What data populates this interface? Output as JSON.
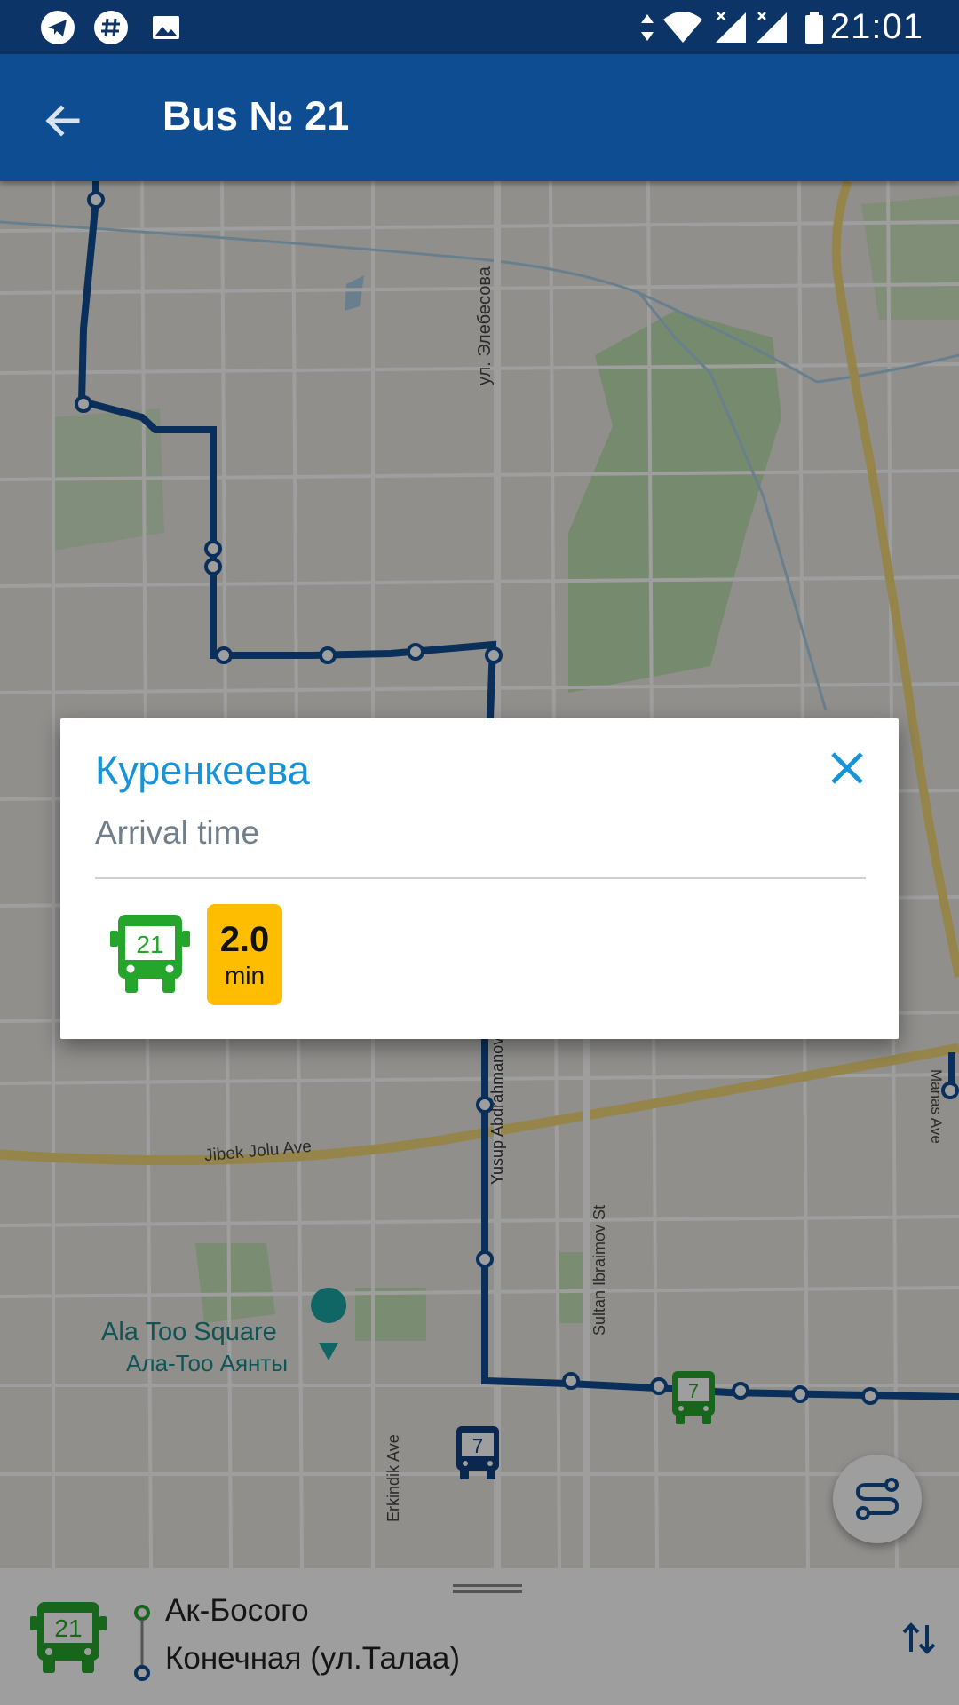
{
  "status_bar": {
    "time": "21:01",
    "left_icons": [
      "telegram-icon",
      "hashtag-icon",
      "image-icon"
    ],
    "right_icons": [
      "data-arrows-icon",
      "wifi-icon",
      "signal-icon",
      "signal-icon",
      "battery-icon"
    ]
  },
  "app_bar": {
    "title": "Bus № 21",
    "back_icon": "arrow-left-icon"
  },
  "map": {
    "street_labels": {
      "elebesova": "ул. Элебесова",
      "jibek_jolu": "Jibek Jolu Ave",
      "yusup": "Yusup Abdrahmanov St",
      "sultan": "Sultan Ibraimov St",
      "erkindik": "Erkindik Ave",
      "manas": "Manas Ave"
    },
    "poi": {
      "name_en": "Ala Too Square",
      "name_ru": "Ала-Тоо Аянты"
    },
    "vehicles": [
      {
        "route": "7",
        "color": "#26a52c"
      },
      {
        "route": "7",
        "color": "#0f3f80"
      }
    ],
    "route_color": "#0f4d92"
  },
  "dialog": {
    "stop_name": "Куренкеева",
    "subtitle": "Arrival time",
    "arrivals": [
      {
        "route": "21",
        "value": "2.0",
        "unit": "min",
        "badge_color": "#ffbd00",
        "icon_color": "#26a52c"
      }
    ],
    "close_icon": "close-icon"
  },
  "bottom_panel": {
    "route_number": "21",
    "from_stop": "Ак-Босого",
    "to_stop": "Конечная (ул.Талаа)",
    "swap_icon": "swap-vertical-icon"
  },
  "fab": {
    "icon": "route-icon"
  }
}
